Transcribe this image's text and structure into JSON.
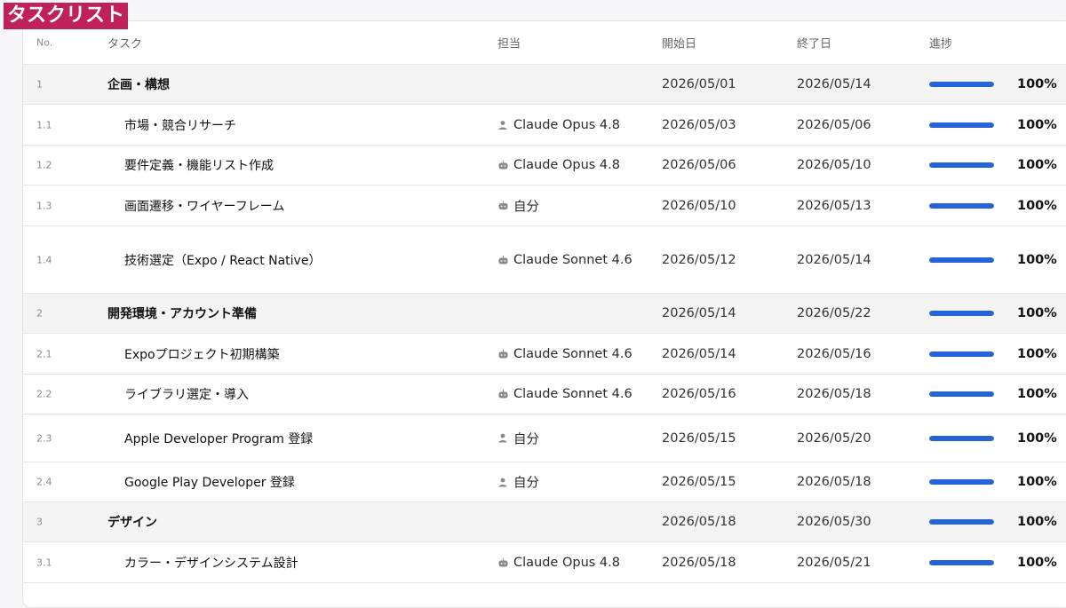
{
  "page_label": "タスクリスト",
  "header": {
    "no": "No.",
    "task": "タスク",
    "assignee": "担当",
    "start": "開始日",
    "end": "終了日",
    "progress": "進捗"
  },
  "rows": [
    {
      "no": "1",
      "kind": "group",
      "task": "企画・構想",
      "assignee": "",
      "assignee_icon": "",
      "start": "2026/05/01",
      "end": "2026/05/14",
      "progress": 1.0,
      "progress_label": "100%"
    },
    {
      "no": "1.1",
      "kind": "child",
      "task": "市場・競合リサーチ",
      "assignee": "Claude Opus 4.8",
      "assignee_icon": "person-icon",
      "start": "2026/05/03",
      "end": "2026/05/06",
      "progress": 1.0,
      "progress_label": "100%"
    },
    {
      "no": "1.2",
      "kind": "child",
      "task": "要件定義・機能リスト作成",
      "assignee": "Claude Opus 4.8",
      "assignee_icon": "bot-icon",
      "start": "2026/05/06",
      "end": "2026/05/10",
      "progress": 1.0,
      "progress_label": "100%"
    },
    {
      "no": "1.3",
      "kind": "child",
      "task": "画面遷移・ワイヤーフレーム",
      "assignee": "自分",
      "assignee_icon": "bot-icon",
      "start": "2026/05/10",
      "end": "2026/05/13",
      "progress": 1.0,
      "progress_label": "100%"
    },
    {
      "no": "1.4",
      "kind": "child",
      "task": "技術選定（Expo / React Native）",
      "assignee": "Claude Sonnet 4.6",
      "assignee_icon": "bot-icon",
      "start": "2026/05/12",
      "end": "2026/05/14",
      "progress": 1.0,
      "progress_label": "100%"
    },
    {
      "no": "2",
      "kind": "group",
      "task": "開発環境・アカウント準備",
      "assignee": "",
      "assignee_icon": "",
      "start": "2026/05/14",
      "end": "2026/05/22",
      "progress": 1.0,
      "progress_label": "100%"
    },
    {
      "no": "2.1",
      "kind": "child",
      "task": "Expoプロジェクト初期構築",
      "assignee": "Claude Sonnet 4.6",
      "assignee_icon": "bot-icon",
      "start": "2026/05/14",
      "end": "2026/05/16",
      "progress": 1.0,
      "progress_label": "100%"
    },
    {
      "no": "2.2",
      "kind": "child",
      "task": "ライブラリ選定・導入",
      "assignee": "Claude Sonnet 4.6",
      "assignee_icon": "bot-icon",
      "start": "2026/05/16",
      "end": "2026/05/18",
      "progress": 1.0,
      "progress_label": "100%"
    },
    {
      "no": "2.3",
      "kind": "child",
      "task": "Apple Developer Program 登録",
      "assignee": "自分",
      "assignee_icon": "person-icon",
      "start": "2026/05/15",
      "end": "2026/05/20",
      "progress": 1.0,
      "progress_label": "100%"
    },
    {
      "no": "2.4",
      "kind": "child",
      "task": "Google Play Developer 登録",
      "assignee": "自分",
      "assignee_icon": "person-icon",
      "start": "2026/05/15",
      "end": "2026/05/18",
      "progress": 1.0,
      "progress_label": "100%"
    },
    {
      "no": "3",
      "kind": "group",
      "task": "デザイン",
      "assignee": "",
      "assignee_icon": "",
      "start": "2026/05/18",
      "end": "2026/05/30",
      "progress": 1.0,
      "progress_label": "100%"
    },
    {
      "no": "3.1",
      "kind": "child",
      "task": "カラー・デザインシステム設計",
      "assignee": "Claude Opus 4.8",
      "assignee_icon": "bot-icon",
      "start": "2026/05/18",
      "end": "2026/05/21",
      "progress": 1.0,
      "progress_label": "100%"
    }
  ],
  "colors": {
    "accent": "#2563d9",
    "label_bg": "#c0215a",
    "group_bg": "#f4f4f5"
  }
}
